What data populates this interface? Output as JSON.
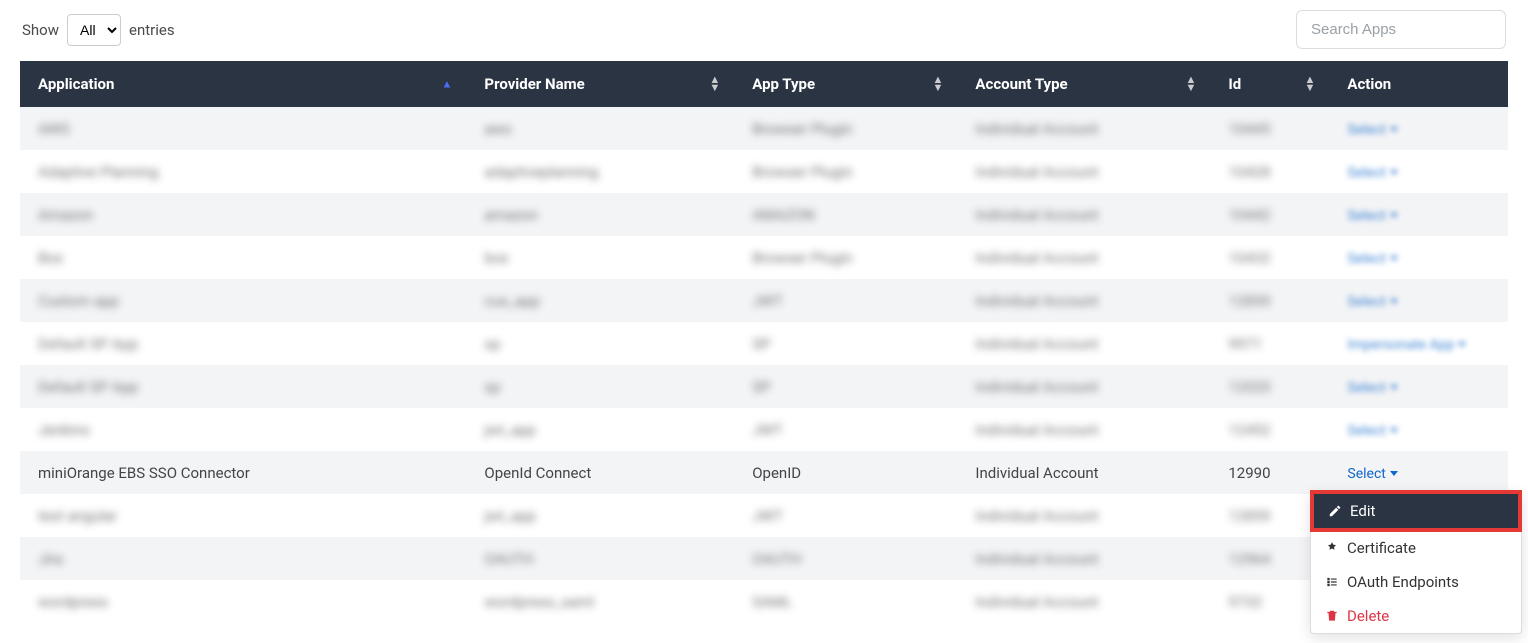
{
  "toolbar": {
    "show_label": "Show",
    "entries_label": "entries",
    "select_value": "All",
    "search_placeholder": "Search Apps"
  },
  "table": {
    "headers": {
      "application": "Application",
      "provider": "Provider Name",
      "app_type": "App Type",
      "account_type": "Account Type",
      "id": "Id",
      "action": "Action"
    },
    "rows": [
      {
        "app": "AWS",
        "prov": "aws",
        "type": "Browser Plugin",
        "acct": "Individual Account",
        "id": "10445",
        "action": "Select",
        "blur": true
      },
      {
        "app": "Adaptive Planning",
        "prov": "adaptiveplanning",
        "type": "Browser Plugin",
        "acct": "Individual Account",
        "id": "10428",
        "action": "Select",
        "blur": true
      },
      {
        "app": "Amazon",
        "prov": "amazon",
        "type": "AMAZON",
        "acct": "Individual Account",
        "id": "10442",
        "action": "Select",
        "blur": true
      },
      {
        "app": "Box",
        "prov": "box",
        "type": "Browser Plugin",
        "acct": "Individual Account",
        "id": "10432",
        "action": "Select",
        "blur": true
      },
      {
        "app": "Custom app",
        "prov": "cus_app",
        "type": "JWT",
        "acct": "Individual Account",
        "id": "12859",
        "action": "Select",
        "blur": true
      },
      {
        "app": "Default SP App",
        "prov": "sp",
        "type": "SP",
        "acct": "Individual Account",
        "id": "9971",
        "action": "Impersonate App",
        "blur": true
      },
      {
        "app": "Default SP App",
        "prov": "sp",
        "type": "SP",
        "acct": "Individual Account",
        "id": "12020",
        "action": "Select",
        "blur": true
      },
      {
        "app": "Jenkins",
        "prov": "jwt_app",
        "type": "JWT",
        "acct": "Individual Account",
        "id": "12452",
        "action": "Select",
        "blur": true
      },
      {
        "app": "miniOrange EBS SSO Connector",
        "prov": "OpenId Connect",
        "type": "OpenID",
        "acct": "Individual Account",
        "id": "12990",
        "action": "Select",
        "blur": false
      },
      {
        "app": "test angular",
        "prov": "jwt_app",
        "type": "JWT",
        "acct": "Individual Account",
        "id": "12859",
        "action": "Select",
        "blur": true
      },
      {
        "app": "Jira",
        "prov": "OAUTH",
        "type": "OAUTH",
        "acct": "Individual Account",
        "id": "12964",
        "action": "Select",
        "blur": true
      },
      {
        "app": "wordpress",
        "prov": "wordpress_saml",
        "type": "SAML",
        "acct": "Individual Account",
        "id": "9732",
        "action": "Select",
        "blur": true
      }
    ]
  },
  "dropdown": {
    "edit": "Edit",
    "certificate": "Certificate",
    "oauth": "OAuth Endpoints",
    "delete": "Delete"
  }
}
